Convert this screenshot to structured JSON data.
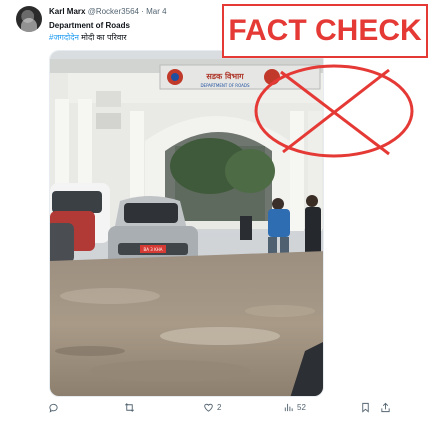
{
  "tweet": {
    "author_name": "Karl Marx",
    "handle": "@Rocker3564",
    "separator": "·",
    "date": "Mar 4",
    "text_line1": "Department of Roads",
    "hashtag": "#जगदोदेन",
    "text_line2_rest": " मोदी का परिवार",
    "overlay_label": "FACT CHECK",
    "media_sign_text": "सडक विभाग",
    "media_sign_subtext": "DEPARTMENT OF ROADS",
    "media_plate_text": "BA 3 KHA"
  },
  "actions": {
    "reply_count": "",
    "retweet_count": "",
    "like_count": "2",
    "views_count": "52"
  },
  "icons": [
    "reply-icon",
    "retweet-icon",
    "heart-icon",
    "views-icon",
    "bookmark-icon",
    "share-icon",
    "more-icon"
  ],
  "colors": {
    "accent": "#1d9bf0",
    "fact_check_red": "#e53935",
    "muted_text": "#536471"
  }
}
